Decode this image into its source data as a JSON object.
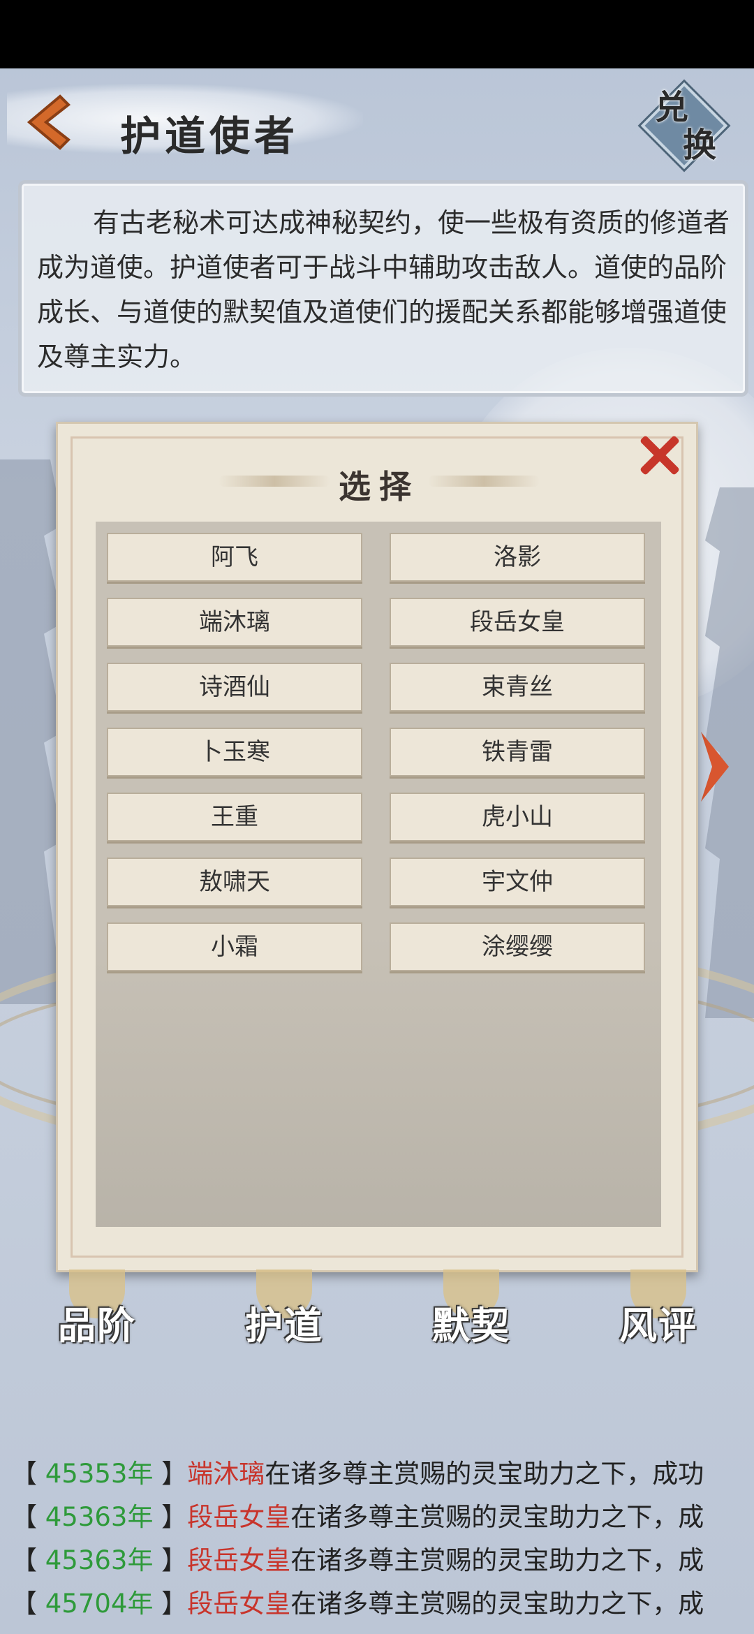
{
  "header": {
    "title": "护道使者",
    "exchange_line1": "兑",
    "exchange_line2": "换"
  },
  "description": "有古老秘术可达成神秘契约，使一些极有资质的修道者成为道使。护道使者可于战斗中辅助攻击敌人。道使的品阶成长、与道使的默契值及道使们的援配关系都能够增强道使及尊主实力。",
  "modal": {
    "title": "选择",
    "options": [
      "阿飞",
      "洛影",
      "端沐璃",
      "段岳女皇",
      "诗酒仙",
      "束青丝",
      "卜玉寒",
      "铁青雷",
      "王重",
      "虎小山",
      "敖啸天",
      "宇文仲",
      "小霜",
      "涂缨缨"
    ]
  },
  "nav": {
    "items": [
      "品阶",
      "护道",
      "默契",
      "风评"
    ]
  },
  "log": {
    "rows": [
      {
        "year": "45353年",
        "name": "端沐璃",
        "text": "在诸多尊主赏赐的灵宝助力之下，成功"
      },
      {
        "year": "45363年",
        "name": "段岳女皇",
        "text": "在诸多尊主赏赐的灵宝助力之下，成"
      },
      {
        "year": "45363年",
        "name": "段岳女皇",
        "text": "在诸多尊主赏赐的灵宝助力之下，成"
      },
      {
        "year": "45704年",
        "name": "段岳女皇",
        "text": "在诸多尊主赏赐的灵宝助力之下，成"
      }
    ]
  },
  "colors": {
    "year": "#2e9a3a",
    "name": "#c8342b",
    "close": "#c7362a"
  }
}
